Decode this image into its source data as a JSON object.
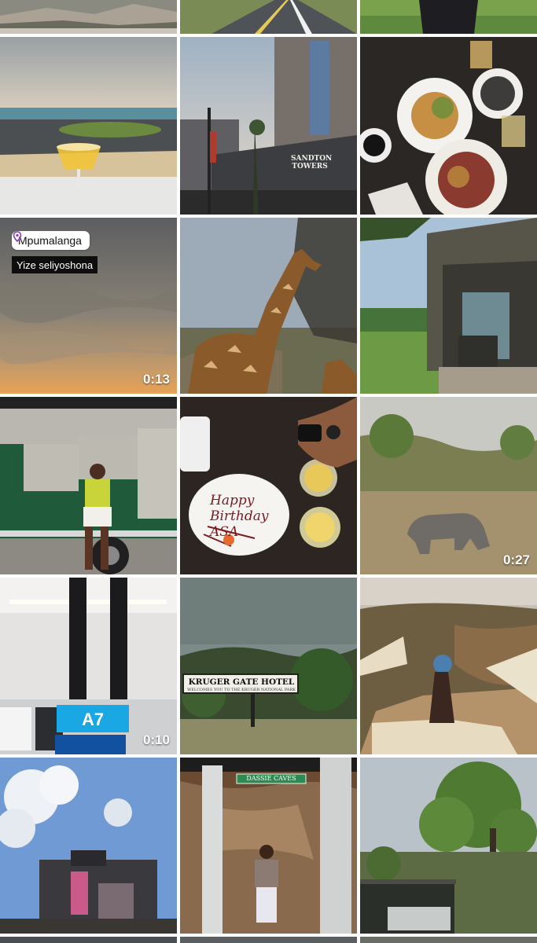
{
  "grid": {
    "tiles": [
      {
        "id": "r0c0",
        "scene": "cliff-rocks"
      },
      {
        "id": "r0c1",
        "scene": "road"
      },
      {
        "id": "r0c2",
        "scene": "grass-person"
      },
      {
        "id": "r1c0",
        "scene": "beach-drink"
      },
      {
        "id": "r1c1",
        "scene": "sandton-towers",
        "sign_text": "SANDTON TOWERS"
      },
      {
        "id": "r1c2",
        "scene": "restaurant-table"
      },
      {
        "id": "r2c0",
        "scene": "sunset-sky",
        "duration": "0:13",
        "location": "Mpumalanga",
        "caption": "Yize seliyoshona"
      },
      {
        "id": "r2c1",
        "scene": "giraffe"
      },
      {
        "id": "r2c2",
        "scene": "safari-tent"
      },
      {
        "id": "r3c0",
        "scene": "safari-vehicle-person"
      },
      {
        "id": "r3c1",
        "scene": "birthday-plate",
        "plate_text": "Happy Birthday ASA"
      },
      {
        "id": "r3c2",
        "scene": "rhino",
        "duration": "0:27"
      },
      {
        "id": "r4c0",
        "scene": "airport-gate",
        "duration": "0:10",
        "gate_text": "A7"
      },
      {
        "id": "r4c1",
        "scene": "kruger-gate",
        "sign_text": "KRUGER GATE HOTEL",
        "sign_subtext": "WELCOMES YOU TO THE KRUGER NATIONAL PARK"
      },
      {
        "id": "r4c2",
        "scene": "canyon-swing"
      },
      {
        "id": "r5c0",
        "scene": "concert-stage"
      },
      {
        "id": "r5c1",
        "scene": "dassie-caves",
        "sign_text": "DASSIE CAVES"
      },
      {
        "id": "r5c2",
        "scene": "tree-safari"
      }
    ]
  },
  "icons": {
    "location_sticker": "location-pin-icon"
  },
  "colors": {
    "sticker_bg": "#ffffff",
    "caption_bg": "#0e0e0e",
    "duration_text": "#ffffff",
    "pin": "#8a3ab9"
  }
}
